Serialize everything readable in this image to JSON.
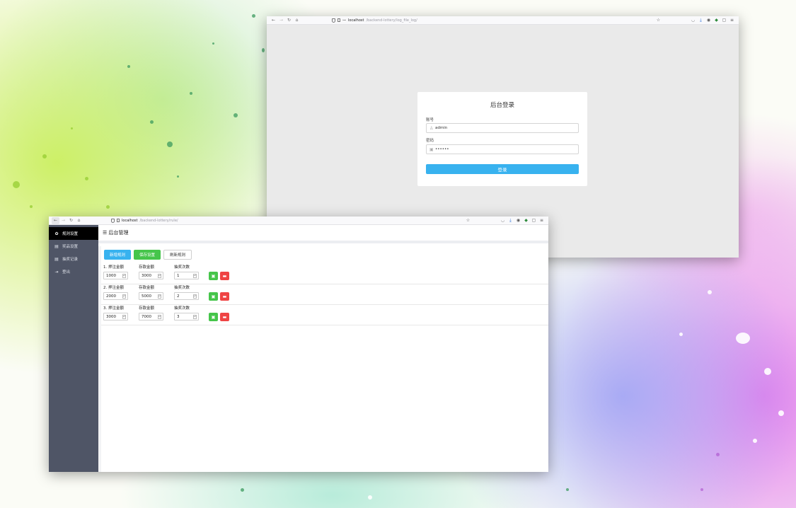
{
  "login_window": {
    "url_host": "localhost",
    "url_path": "/backend-lottery/log_file_log/",
    "title": "后台登录",
    "account_label": "账号",
    "account_value": "admin",
    "password_label": "密码",
    "password_value": "••••••",
    "login_button": "登录"
  },
  "admin_window": {
    "url_host": "localhost",
    "url_path": "/backend-lottery/rule/",
    "header_title": "☰ 后台管理",
    "sidebar": [
      {
        "label": "规则设置",
        "icon": "gear-icon",
        "active": true
      },
      {
        "label": "奖品设置",
        "icon": "table-icon",
        "active": false
      },
      {
        "label": "抽奖记录",
        "icon": "table-icon",
        "active": false
      },
      {
        "label": "登出",
        "icon": "logout-icon",
        "active": false
      }
    ],
    "toolbar": {
      "add": "新增规则",
      "save": "保存设置",
      "refresh": "刷新规则"
    },
    "columns": [
      "押注金额",
      "存款金额",
      "抽奖次数"
    ],
    "rules": [
      {
        "index": "1",
        "bet": "1000",
        "deposit": "3000",
        "draws": "1"
      },
      {
        "index": "2",
        "bet": "2000",
        "deposit": "5000",
        "draws": "2"
      },
      {
        "index": "3",
        "bet": "3000",
        "deposit": "7000",
        "draws": "3"
      }
    ]
  },
  "colors": {
    "primary_blue": "#38b2ef",
    "save_green": "#46c54b",
    "delete_red": "#ef4444",
    "sidebar_bg": "#4f5566"
  }
}
